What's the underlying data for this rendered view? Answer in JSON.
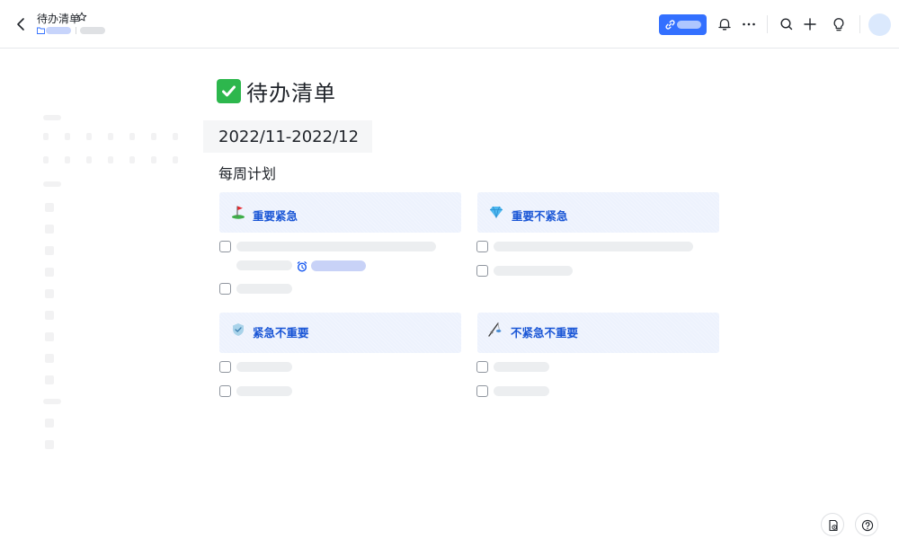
{
  "header": {
    "doc_title": "待办清单"
  },
  "page": {
    "title": "待办清单",
    "date_range": "2022/11-2022/12",
    "section_title": "每周计划"
  },
  "quadrants": [
    {
      "label": "重要紧急",
      "emoji": "golf-flag-icon"
    },
    {
      "label": "重要不紧急",
      "emoji": "gem-icon"
    },
    {
      "label": "紧急不重要",
      "emoji": "shield-icon"
    },
    {
      "label": "不紧急不重要",
      "emoji": "fishing-pole-icon"
    }
  ],
  "colors": {
    "accent": "#3370ff",
    "quadrant_bg": "#edf2fd",
    "quadrant_text": "#1a56d6",
    "placeholder_bar": "#eceef0"
  }
}
